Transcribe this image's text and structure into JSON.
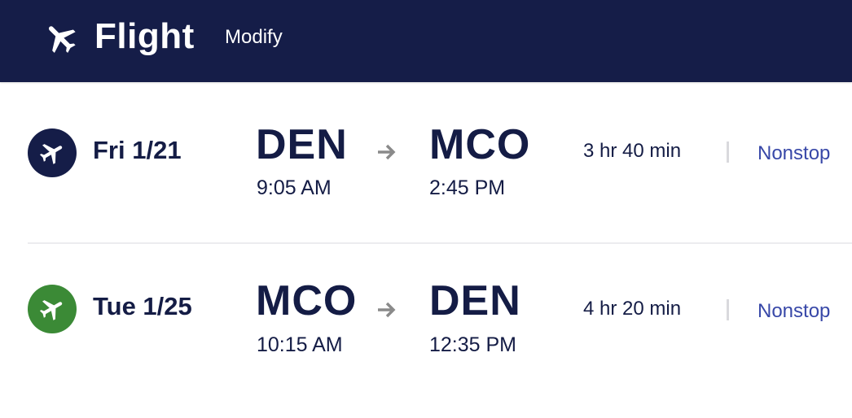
{
  "header": {
    "title": "Flight",
    "modify_label": "Modify",
    "icon": "airplane-icon",
    "background": "#151d48"
  },
  "flights": [
    {
      "date": "Fri 1/21",
      "badge_icon": "airplane-takeoff-icon",
      "badge_color": "#151d48",
      "departure": {
        "code": "DEN",
        "time": "9:05 AM"
      },
      "arrival": {
        "code": "MCO",
        "time": "2:45 PM"
      },
      "duration": "3 hr 40 min",
      "stops": "Nonstop"
    },
    {
      "date": "Tue 1/25",
      "badge_icon": "airplane-takeoff-icon",
      "badge_color": "#3b8a36",
      "departure": {
        "code": "MCO",
        "time": "10:15 AM"
      },
      "arrival": {
        "code": "DEN",
        "time": "12:35 PM"
      },
      "duration": "4 hr 20 min",
      "stops": "Nonstop"
    }
  ],
  "colors": {
    "text": "#141c45",
    "link": "#3848a8",
    "arrow": "#8a8a8a",
    "divider": "#ececef"
  }
}
